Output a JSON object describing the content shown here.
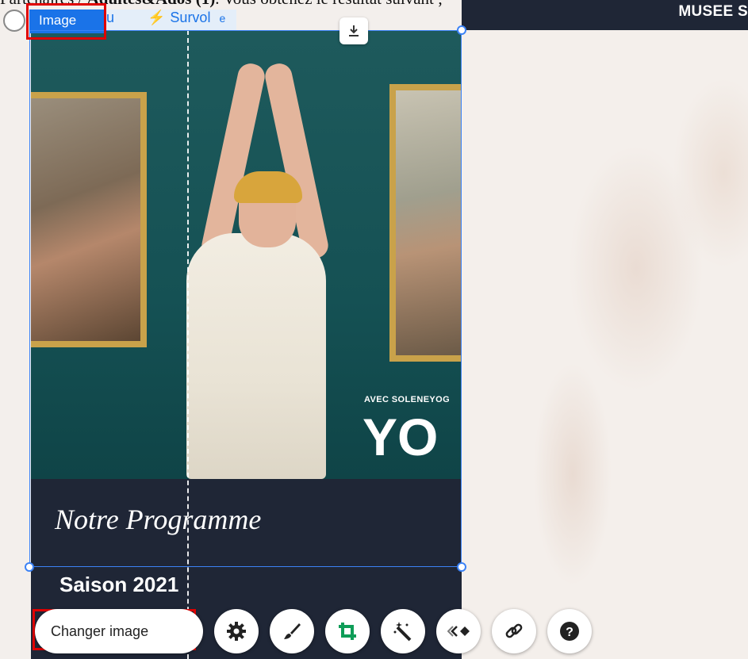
{
  "doc_text": {
    "part1": "Partenaires / ",
    "part2": "Adultes&Ados (1)",
    "part3": ". Vous obtenez le résultat suivant ;"
  },
  "site_title": "MUSEE S",
  "tabs": {
    "image_label": "Image",
    "survol_label": "Survol",
    "hidden_left": "eau",
    "hidden_right": "e"
  },
  "hero": {
    "small_text": "AVEC SOLENEYOG",
    "big_text": "YO"
  },
  "programme_title": "Notre Programme",
  "season_title": "Saison 2021",
  "toolbar": {
    "change_image_label": "Changer image",
    "icons": [
      "gear-icon",
      "brush-icon",
      "crop-icon",
      "magic-wand-icon",
      "animation-icon",
      "link-icon",
      "help-icon"
    ]
  },
  "colors": {
    "accent": "#1a73e8",
    "dark_bg": "#1f2636",
    "crop_green": "#0f9d58",
    "highlight_red": "#e00000"
  }
}
